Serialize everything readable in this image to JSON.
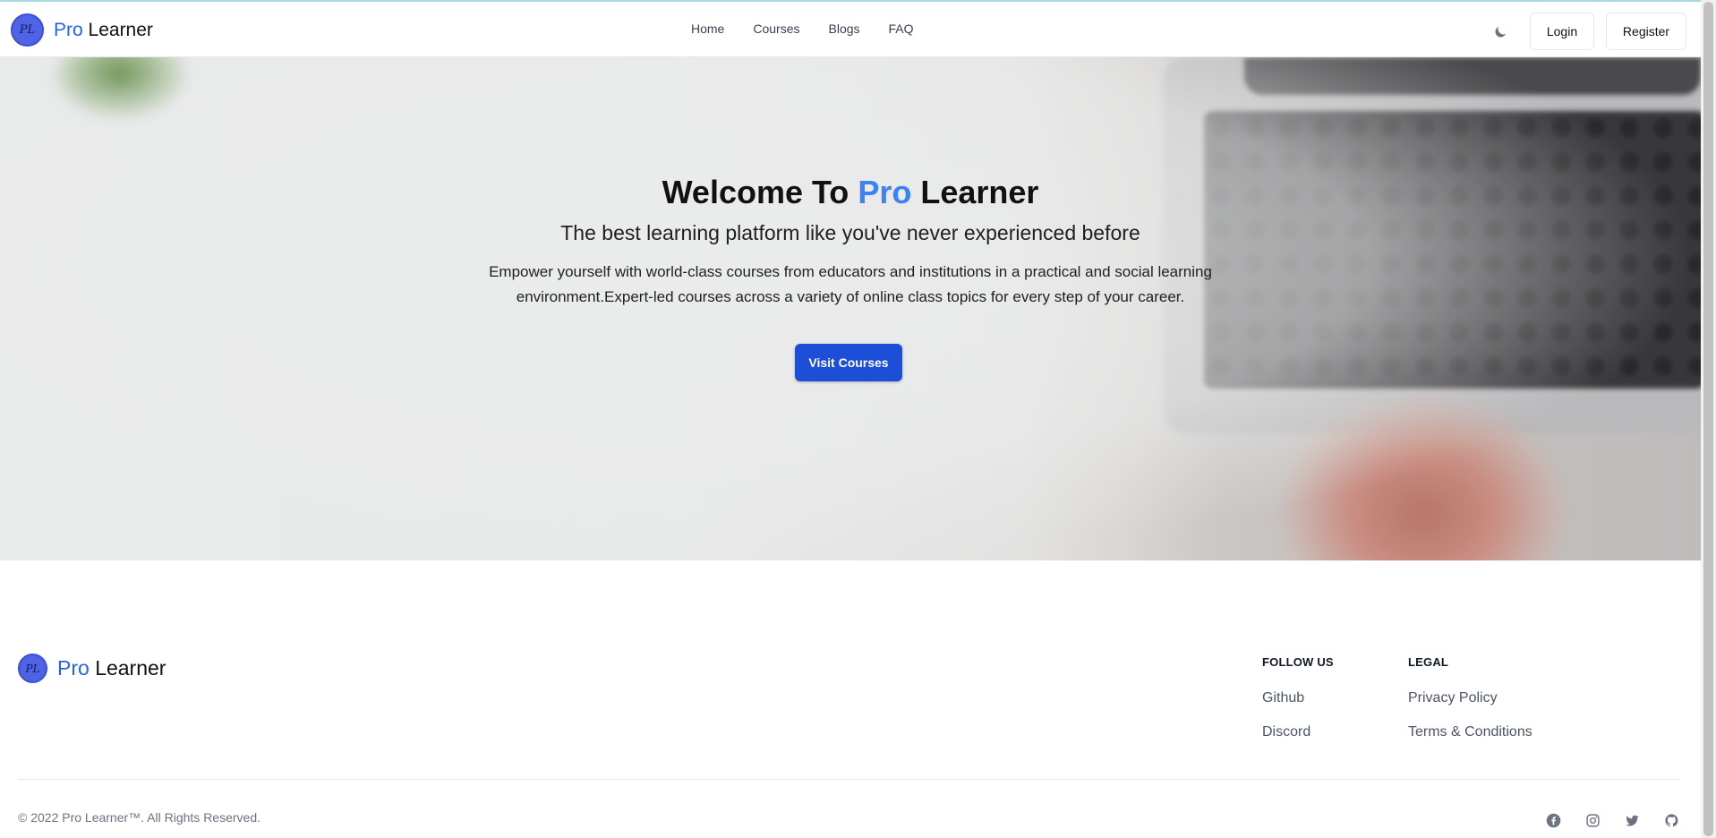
{
  "brand": {
    "prefix": "Pro",
    "suffix": "Learner",
    "logo_text": "PL"
  },
  "nav": {
    "links": [
      "Home",
      "Courses",
      "Blogs",
      "FAQ"
    ],
    "login_label": "Login",
    "register_label": "Register",
    "theme_icon": "moon-icon"
  },
  "hero": {
    "title_prefix": "Welcome To ",
    "title_accent": "Pro",
    "title_suffix": " Learner",
    "subtitle": "The best learning platform like you've never experienced before",
    "description": "Empower yourself with world-class courses from educators and institutions in a practical and social learning environment.Expert-led courses across a variety of online class topics for every step of your career.",
    "cta_label": "Visit Courses"
  },
  "footer": {
    "follow_heading": "FOLLOW US",
    "follow_links": [
      "Github",
      "Discord"
    ],
    "legal_heading": "LEGAL",
    "legal_links": [
      "Privacy Policy",
      "Terms & Conditions"
    ],
    "copyright": "© 2022 Pro Learner™. All Rights Reserved.",
    "social_icons": [
      "facebook-icon",
      "instagram-icon",
      "twitter-icon",
      "github-icon"
    ]
  },
  "colors": {
    "accent": "#2563eb",
    "cta": "#1d4ed8"
  }
}
